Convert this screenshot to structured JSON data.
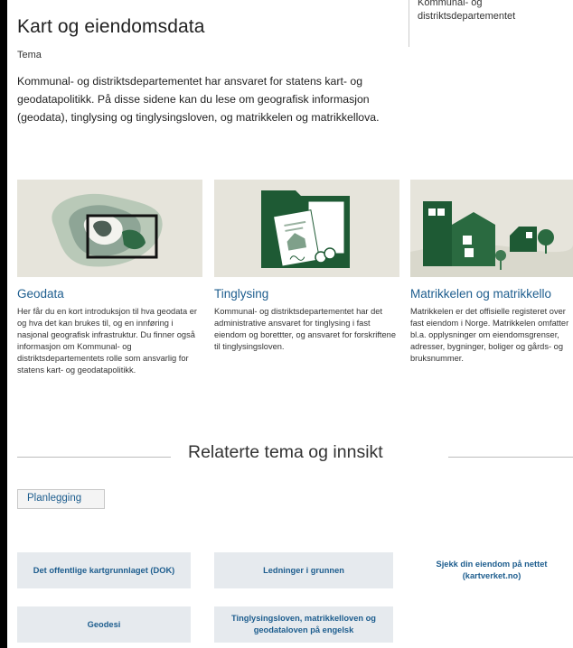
{
  "header": {
    "title": "Kart og eiendomsdata",
    "subtitle": "Tema"
  },
  "sidebar": {
    "department": "Kommunal- og distriktsdepartementet"
  },
  "intro": "Kommunal- og distriktsdepartementet har ansvaret for statens kart- og geodatapolitikk. På disse sidene kan du lese om geografisk informasjon (geodata), tinglysing og tinglysingsloven, og matrikkelen og matrikkellova.",
  "cards": [
    {
      "title": "Geodata",
      "text": "Her får du en kort introduksjon til hva geodata er og hva det kan brukes til, og en innføring i nasjonal geografisk infrastruktur. Du finner også informasjon om Kommunal- og distriktsdepartementets rolle som ansvarlig for statens kart- og geodatapolitikk."
    },
    {
      "title": "Tinglysing",
      "text": "Kommunal- og distriktsdepartementet har det administrative ansvaret for tinglysing i fast eiendom og borettter, og ansvaret for forskriftene til tinglysingsloven."
    },
    {
      "title": "Matrikkelen og matrikkello",
      "text": "Matrikkelen er det offisielle registeret over fast eiendom i Norge. Matrikkelen omfatter bl.a. opplysninger om eiendomsgrenser, adresser, bygninger, boliger og gårds- og bruksnummer."
    }
  ],
  "related": {
    "heading": "Relaterte tema og innsikt",
    "tag": "Planlegging",
    "links": [
      "Det offentlige kartgrunnlaget (DOK)",
      "Ledninger i grunnen",
      "Sjekk din eiendom på nettet (kartverket.no)",
      "Geodesi",
      "Tinglysingsloven, matrikkelloven og geodataloven på engelsk"
    ]
  },
  "colors": {
    "link": "#1d5d8e",
    "green_dark": "#1e5a34",
    "card_bg": "#e6e4db",
    "tile_bg": "#e6eaee"
  }
}
